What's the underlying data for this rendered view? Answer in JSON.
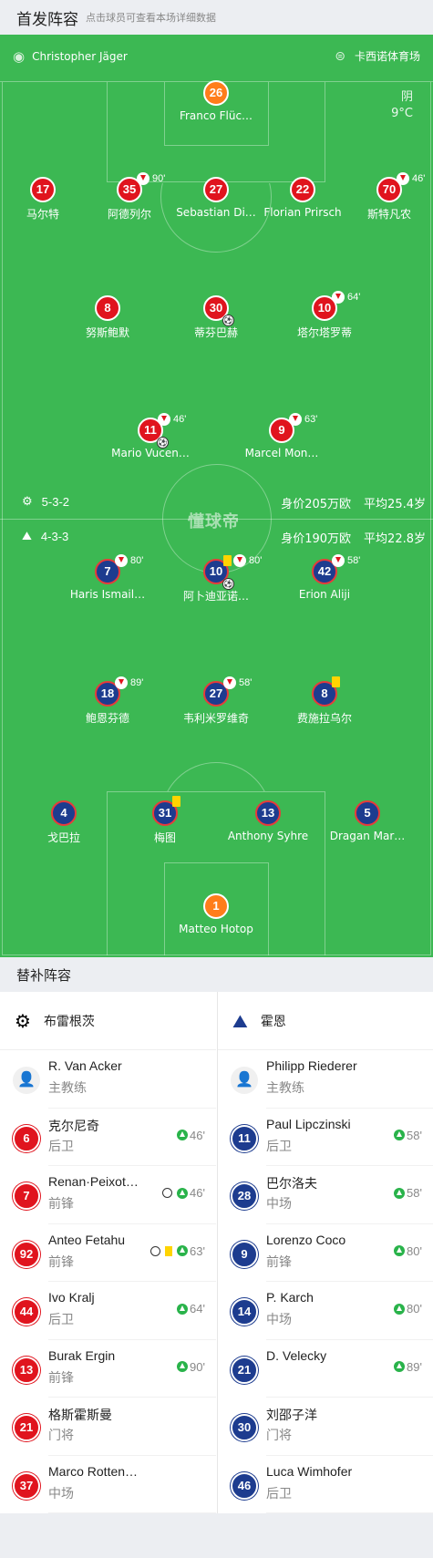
{
  "header": {
    "title": "首发阵容",
    "subtitle": "点击球员可查看本场详细数据"
  },
  "match": {
    "referee": "Christopher Jäger",
    "venue": "卡西诺体育场",
    "weather": "阴",
    "temperature": "9°C",
    "watermark": "懂球帝"
  },
  "home": {
    "formation": "5-3-2",
    "value": "身价205万欧",
    "age": "平均25.4岁",
    "players": [
      {
        "num": "26",
        "name": "Franco Flüc…",
        "gk": true
      },
      {
        "num": "17",
        "name": "马尔特"
      },
      {
        "num": "35",
        "name": "阿德列尔",
        "sub": "90'"
      },
      {
        "num": "27",
        "name": "Sebastian Di…"
      },
      {
        "num": "22",
        "name": "Florian Prirsch"
      },
      {
        "num": "70",
        "name": "斯特凡农",
        "sub": "46'"
      },
      {
        "num": "8",
        "name": "努斯鲍默"
      },
      {
        "num": "30",
        "name": "蒂芬巴赫"
      },
      {
        "num": "10",
        "name": "塔尔塔罗蒂",
        "sub": "64'"
      },
      {
        "num": "11",
        "name": "Mario Vucen…",
        "sub": "46'"
      },
      {
        "num": "9",
        "name": "Marcel Mon…",
        "sub": "63'"
      }
    ]
  },
  "away": {
    "formation": "4-3-3",
    "value": "身价190万欧",
    "age": "平均22.8岁",
    "players": [
      {
        "num": "7",
        "name": "Haris Ismail…",
        "sub": "80'"
      },
      {
        "num": "10",
        "name": "阿卜迪亚诺…",
        "sub": "80'"
      },
      {
        "num": "42",
        "name": "Erion Aliji",
        "sub": "58'"
      },
      {
        "num": "18",
        "name": "鲍恩芬德",
        "sub": "89'"
      },
      {
        "num": "27",
        "name": "韦利米罗维奇",
        "sub": "58'"
      },
      {
        "num": "8",
        "name": "费施拉乌尔"
      },
      {
        "num": "4",
        "name": "戈巴拉"
      },
      {
        "num": "31",
        "name": "梅图"
      },
      {
        "num": "13",
        "name": "Anthony Syhre"
      },
      {
        "num": "5",
        "name": "Dragan Mar…"
      },
      {
        "num": "1",
        "name": "Matteo Hotop",
        "gk": true
      }
    ]
  },
  "subs": {
    "title": "替补阵容",
    "home_team": "布雷根茨",
    "away_team": "霍恩",
    "home": [
      {
        "num": "",
        "name": "R. Van Acker",
        "pos": "主教练",
        "coach": true
      },
      {
        "num": "6",
        "name": "克尔尼奇",
        "pos": "后卫",
        "time": "46'"
      },
      {
        "num": "7",
        "name": "Renan·Peixot…",
        "pos": "前锋",
        "time": "46'",
        "goal": true
      },
      {
        "num": "92",
        "name": "Anteo Fetahu",
        "pos": "前锋",
        "time": "63'",
        "goal": true,
        "yellow": true
      },
      {
        "num": "44",
        "name": "Ivo Kralj",
        "pos": "后卫",
        "time": "64'"
      },
      {
        "num": "13",
        "name": "Burak Ergin",
        "pos": "前锋",
        "time": "90'"
      },
      {
        "num": "21",
        "name": "格斯霍斯曼",
        "pos": "门将"
      },
      {
        "num": "37",
        "name": "Marco Rotten…",
        "pos": "中场"
      }
    ],
    "away": [
      {
        "num": "",
        "name": "Philipp Riederer",
        "pos": "主教练",
        "coach": true
      },
      {
        "num": "11",
        "name": "Paul Lipczinski",
        "pos": "后卫",
        "time": "58'"
      },
      {
        "num": "28",
        "name": "巴尔洛夫",
        "pos": "中场",
        "time": "58'"
      },
      {
        "num": "9",
        "name": "Lorenzo Coco",
        "pos": "前锋",
        "time": "80'"
      },
      {
        "num": "14",
        "name": "P. Karch",
        "pos": "中场",
        "time": "80'"
      },
      {
        "num": "21",
        "name": "D. Velecky",
        "pos": "",
        "time": "89'"
      },
      {
        "num": "30",
        "name": "刘邵子洋",
        "pos": "门将"
      },
      {
        "num": "46",
        "name": "Luca Wimhofer",
        "pos": "后卫"
      }
    ]
  },
  "colors": {
    "pitch": "#3cb853",
    "home": "#e0141e",
    "away": "#1d3c8f",
    "gk": "#ff7d1b"
  }
}
